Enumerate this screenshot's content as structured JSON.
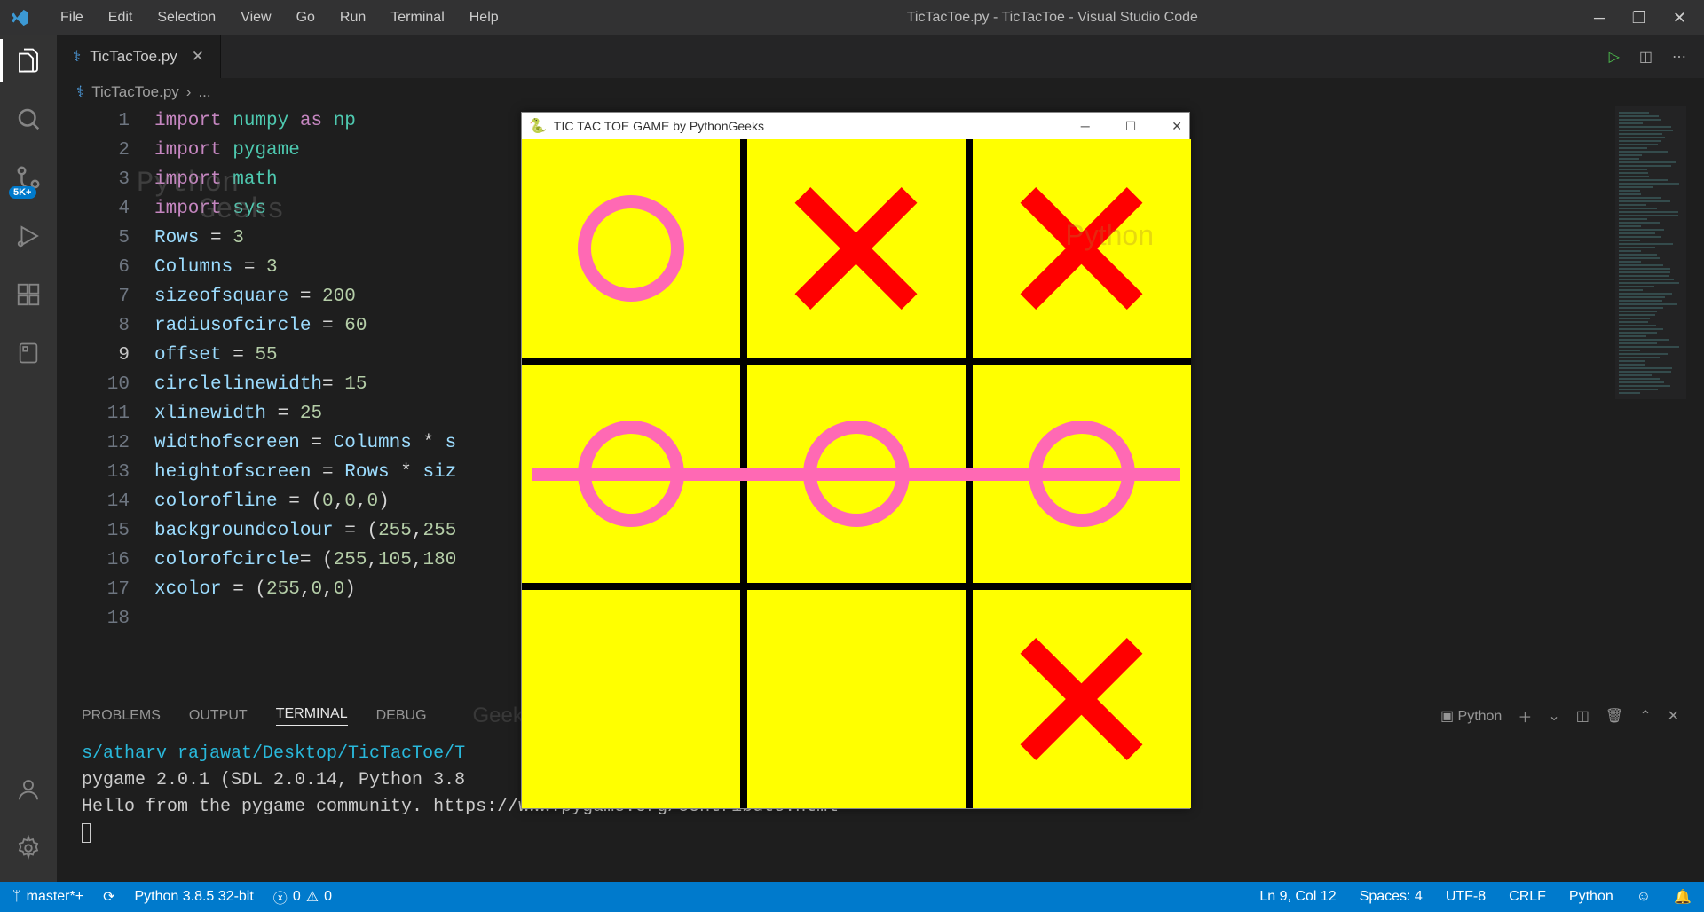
{
  "menubar": {
    "items": [
      "File",
      "Edit",
      "Selection",
      "View",
      "Go",
      "Run",
      "Terminal",
      "Help"
    ],
    "title": "TicTacToe.py - TicTacToe - Visual Studio Code"
  },
  "activitybar": {
    "scm_badge": "5K+"
  },
  "tab": {
    "label": "TicTacToe.py"
  },
  "breadcrumb": {
    "file": "TicTacToe.py",
    "sep": "›",
    "more": "..."
  },
  "editor": {
    "active_line": 9,
    "lines": [
      {
        "n": 1,
        "html": "<span class='tok-kw'>import</span> <span class='tok-mod'>numpy</span> <span class='tok-as'>as</span> <span class='tok-mod'>np</span>"
      },
      {
        "n": 2,
        "html": "<span class='tok-kw'>import</span> <span class='tok-mod'>pygame</span>"
      },
      {
        "n": 3,
        "html": "<span class='tok-kw'>import</span> <span class='tok-mod'>math</span>"
      },
      {
        "n": 4,
        "html": "<span class='tok-kw'>import</span> <span class='tok-mod'>sys</span>"
      },
      {
        "n": 5,
        "html": "<span class='tok-var'>Rows</span> = <span class='tok-num'>3</span>"
      },
      {
        "n": 6,
        "html": "<span class='tok-var'>Columns</span> = <span class='tok-num'>3</span>"
      },
      {
        "n": 7,
        "html": "<span class='tok-var'>sizeofsquare</span> = <span class='tok-num'>200</span>"
      },
      {
        "n": 8,
        "html": "<span class='tok-var'>radiusofcircle</span> = <span class='tok-num'>60</span>"
      },
      {
        "n": 9,
        "html": "<span class='tok-var'>offset</span> = <span class='tok-num'>55</span>"
      },
      {
        "n": 10,
        "html": "<span class='tok-var'>circlelinewidth</span>= <span class='tok-num'>15</span>"
      },
      {
        "n": 11,
        "html": "<span class='tok-var'>xlinewidth</span> = <span class='tok-num'>25</span>"
      },
      {
        "n": 12,
        "html": "<span class='tok-var'>widthofscreen</span> = <span class='tok-var'>Columns</span> * <span class='tok-var'>s</span>"
      },
      {
        "n": 13,
        "html": "<span class='tok-var'>heightofscreen</span> = <span class='tok-var'>Rows</span> * <span class='tok-var'>siz</span>"
      },
      {
        "n": 14,
        "html": "<span class='tok-var'>colorofline</span> = (<span class='tok-num'>0</span>,<span class='tok-num'>0</span>,<span class='tok-num'>0</span>)"
      },
      {
        "n": 15,
        "html": "<span class='tok-var'>backgroundcolour</span> = (<span class='tok-num'>255</span>,<span class='tok-num'>255</span>"
      },
      {
        "n": 16,
        "html": "<span class='tok-var'>colorofcircle</span>= (<span class='tok-num'>255</span>,<span class='tok-num'>105</span>,<span class='tok-num'>180</span>"
      },
      {
        "n": 17,
        "html": "<span class='tok-var'>xcolor</span> = (<span class='tok-num'>255</span>,<span class='tok-num'>0</span>,<span class='tok-num'>0</span>)"
      },
      {
        "n": 18,
        "html": ""
      }
    ]
  },
  "terminal": {
    "tabs": [
      "PROBLEMS",
      "OUTPUT",
      "TERMINAL",
      "DEBUG"
    ],
    "active_tab": "TERMINAL",
    "shell_label": "Python",
    "path_line": "s/atharv rajawat/Desktop/TicTacToe/T",
    "line2": "pygame 2.0.1 (SDL 2.0.14, Python 3.8",
    "line3": "Hello from the pygame community. https://www.pygame.org/contribute.html"
  },
  "statusbar": {
    "branch": "master*+",
    "sync": "⟳",
    "python_env": "Python 3.8.5 32-bit",
    "errors": "0",
    "warnings": "0",
    "cursor": "Ln 9, Col 12",
    "spaces": "Spaces: 4",
    "encoding": "UTF-8",
    "eol": "CRLF",
    "lang": "Python"
  },
  "popup": {
    "title": "TIC TAC TOE GAME by PythonGeeks",
    "board": [
      [
        "O",
        "X",
        "X"
      ],
      [
        "O",
        "O",
        "O"
      ],
      [
        "",
        "",
        "X"
      ]
    ],
    "win_row": 1
  },
  "watermarks": {
    "w1": "Python",
    "w2": "Geeks"
  }
}
